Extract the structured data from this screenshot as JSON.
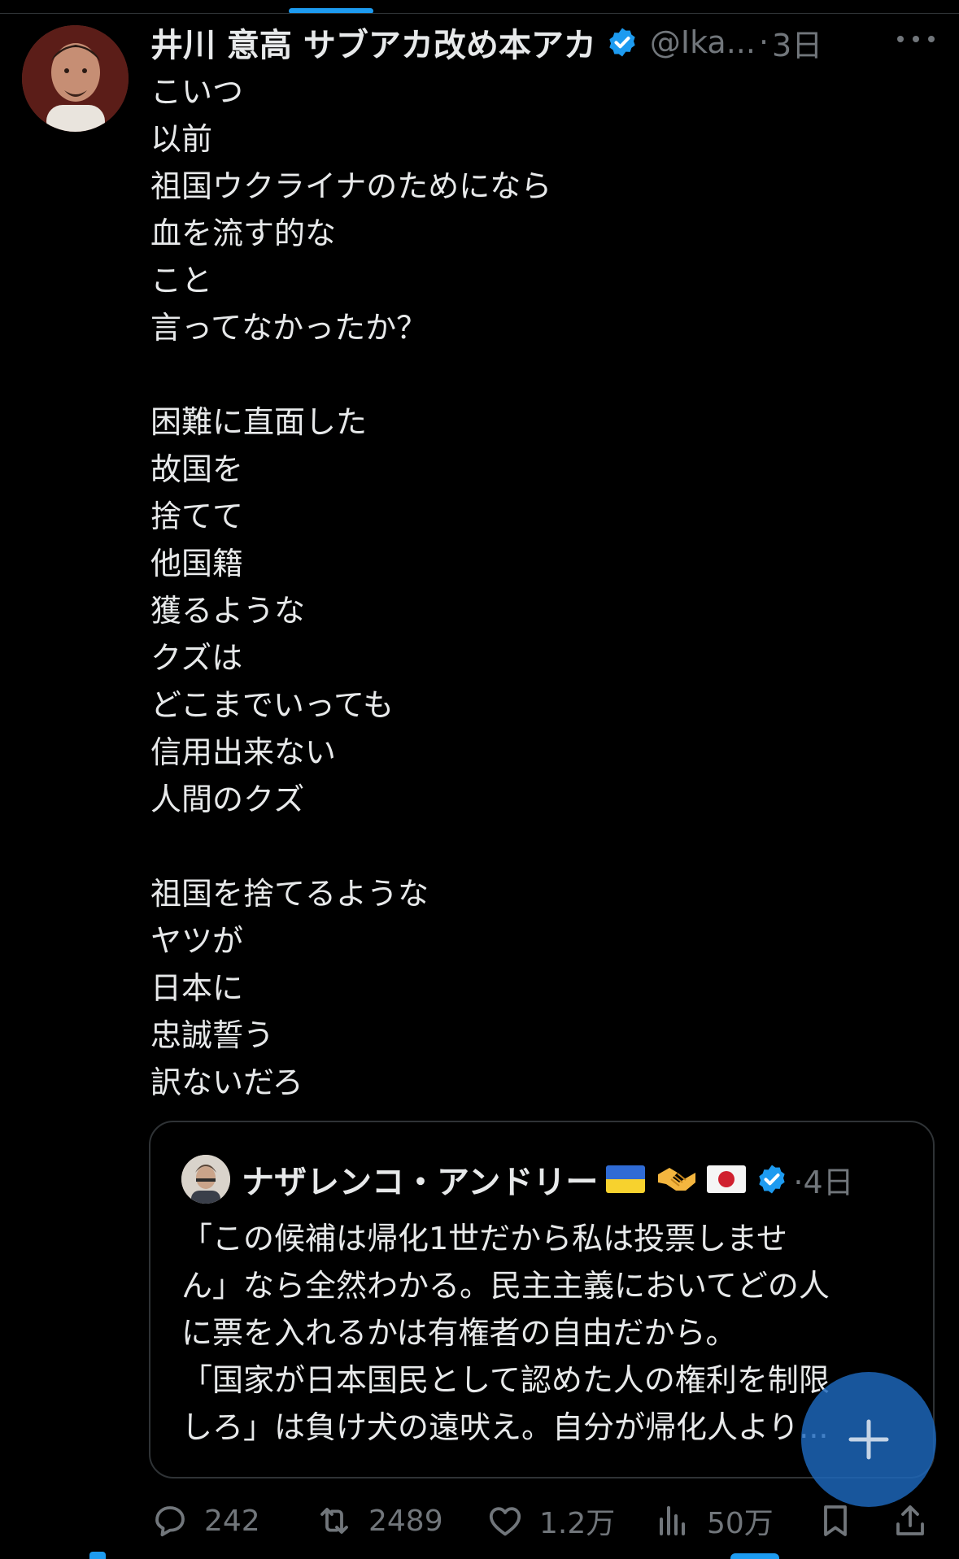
{
  "colors": {
    "background": "#000000",
    "text": "#e7e9ea",
    "muted": "#71767b",
    "accent": "#1d9bf0",
    "border": "#2f3336"
  },
  "post": {
    "author_name": "井川 意高 サブアカ改め本アカ",
    "handle": "@Ika...",
    "separator": "·",
    "time": "3日",
    "verified_icon": "verified-badge-icon",
    "more_icon": "more-horizontal-icon",
    "lines": [
      "こいつ",
      "以前",
      "祖国ウクライナのためになら",
      "血を流す的な",
      "こと",
      "言ってなかったか？",
      "",
      "困難に直面した",
      "故国を",
      "捨てて",
      "他国籍",
      "獲るような",
      "クズは",
      "どこまでいっても",
      "信用出来ない",
      "人間のクズ",
      "",
      "祖国を捨てるような",
      "ヤツが",
      "日本に",
      "忠誠誓う",
      "訳ないだろ"
    ]
  },
  "quote": {
    "author_name": "ナザレンコ・アンドリー",
    "flags": [
      "ukraine-flag-icon",
      "handshake-icon",
      "japan-flag-icon"
    ],
    "separator": "·",
    "time": "4日",
    "lines": [
      "「この候補は帰化1世だから私は投票しませ",
      "ん」なら全然わかる。民主主義においてどの人",
      "に票を入れるかは有権者の自由だから。",
      "「国家が日本国民として認めた人の権利を制限",
      "しろ」は負け犬の遠吠え。自分が帰化人より..."
    ]
  },
  "actions": {
    "reply": {
      "icon": "reply-icon",
      "count": "242"
    },
    "repost": {
      "icon": "repost-icon",
      "count": "2489"
    },
    "like": {
      "icon": "heart-icon",
      "count": "1.2万"
    },
    "views": {
      "icon": "views-chart-icon",
      "count": "50万"
    },
    "bookmark": {
      "icon": "bookmark-icon"
    },
    "share": {
      "icon": "share-icon"
    }
  },
  "fab": {
    "icon": "plus-icon"
  }
}
